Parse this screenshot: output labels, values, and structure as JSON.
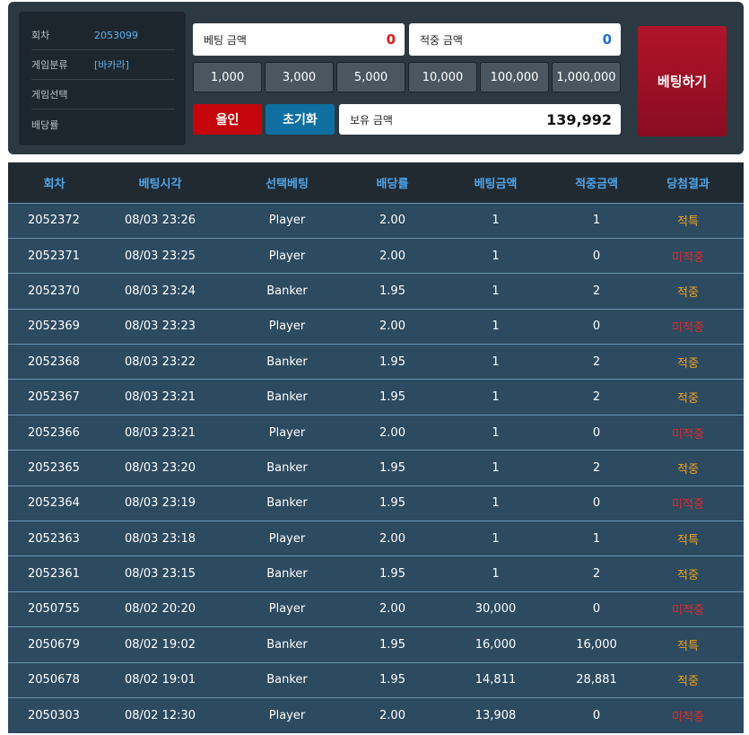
{
  "info": {
    "round_label": "회차",
    "round_value": "2053099",
    "category_label": "게임분류",
    "category_value": "[바카라]",
    "select_label": "게임선택",
    "select_value": "",
    "odds_label": "배당률",
    "odds_value": ""
  },
  "amounts": {
    "bet_label": "베팅 금액",
    "bet_value": "0",
    "win_label": "적중 금액",
    "win_value": "0",
    "balance_label": "보유 금액",
    "balance_value": "139,992"
  },
  "chips": [
    "1,000",
    "3,000",
    "5,000",
    "10,000",
    "100,000",
    "1,000,000"
  ],
  "buttons": {
    "allin": "올인",
    "reset": "초기화",
    "bet": "베팅하기"
  },
  "table": {
    "headers": [
      "회차",
      "베팅시각",
      "선택베팅",
      "배당률",
      "베팅금액",
      "적중금액",
      "당첨결과"
    ],
    "rows": [
      {
        "round": "2052372",
        "time": "08/03 23:26",
        "pick": "Player",
        "odds": "2.00",
        "bet": "1",
        "win": "1",
        "result": "적특",
        "status": "gold"
      },
      {
        "round": "2052371",
        "time": "08/03 23:25",
        "pick": "Player",
        "odds": "2.00",
        "bet": "1",
        "win": "0",
        "result": "미적중",
        "status": "red"
      },
      {
        "round": "2052370",
        "time": "08/03 23:24",
        "pick": "Banker",
        "odds": "1.95",
        "bet": "1",
        "win": "2",
        "result": "적중",
        "status": "gold"
      },
      {
        "round": "2052369",
        "time": "08/03 23:23",
        "pick": "Player",
        "odds": "2.00",
        "bet": "1",
        "win": "0",
        "result": "미적중",
        "status": "red"
      },
      {
        "round": "2052368",
        "time": "08/03 23:22",
        "pick": "Banker",
        "odds": "1.95",
        "bet": "1",
        "win": "2",
        "result": "적중",
        "status": "gold"
      },
      {
        "round": "2052367",
        "time": "08/03 23:21",
        "pick": "Banker",
        "odds": "1.95",
        "bet": "1",
        "win": "2",
        "result": "적중",
        "status": "gold"
      },
      {
        "round": "2052366",
        "time": "08/03 23:21",
        "pick": "Player",
        "odds": "2.00",
        "bet": "1",
        "win": "0",
        "result": "미적중",
        "status": "red"
      },
      {
        "round": "2052365",
        "time": "08/03 23:20",
        "pick": "Banker",
        "odds": "1.95",
        "bet": "1",
        "win": "2",
        "result": "적중",
        "status": "gold"
      },
      {
        "round": "2052364",
        "time": "08/03 23:19",
        "pick": "Banker",
        "odds": "1.95",
        "bet": "1",
        "win": "0",
        "result": "미적중",
        "status": "red"
      },
      {
        "round": "2052363",
        "time": "08/03 23:18",
        "pick": "Player",
        "odds": "2.00",
        "bet": "1",
        "win": "1",
        "result": "적특",
        "status": "gold"
      },
      {
        "round": "2052361",
        "time": "08/03 23:15",
        "pick": "Banker",
        "odds": "1.95",
        "bet": "1",
        "win": "2",
        "result": "적중",
        "status": "gold"
      },
      {
        "round": "2050755",
        "time": "08/02 20:20",
        "pick": "Player",
        "odds": "2.00",
        "bet": "30,000",
        "win": "0",
        "result": "미적중",
        "status": "red"
      },
      {
        "round": "2050679",
        "time": "08/02 19:02",
        "pick": "Banker",
        "odds": "1.95",
        "bet": "16,000",
        "win": "16,000",
        "result": "적특",
        "status": "gold"
      },
      {
        "round": "2050678",
        "time": "08/02 19:01",
        "pick": "Banker",
        "odds": "1.95",
        "bet": "14,811",
        "win": "28,881",
        "result": "적중",
        "status": "gold"
      },
      {
        "round": "2050303",
        "time": "08/02 12:30",
        "pick": "Player",
        "odds": "2.00",
        "bet": "13,908",
        "win": "0",
        "result": "미적중",
        "status": "red"
      }
    ]
  },
  "colors": {
    "panel_bg": "#2c3942",
    "info_value": "#5fb3f0",
    "allin_red": "#c4060c",
    "reset_blue": "#0e6fa0",
    "bet_button": "#a0112a",
    "row_bg": "#2c4a60",
    "header_bg": "#222a31",
    "header_text": "#4ea6ec",
    "result_gold": "#f0a21a",
    "result_red": "#e22a2a"
  }
}
